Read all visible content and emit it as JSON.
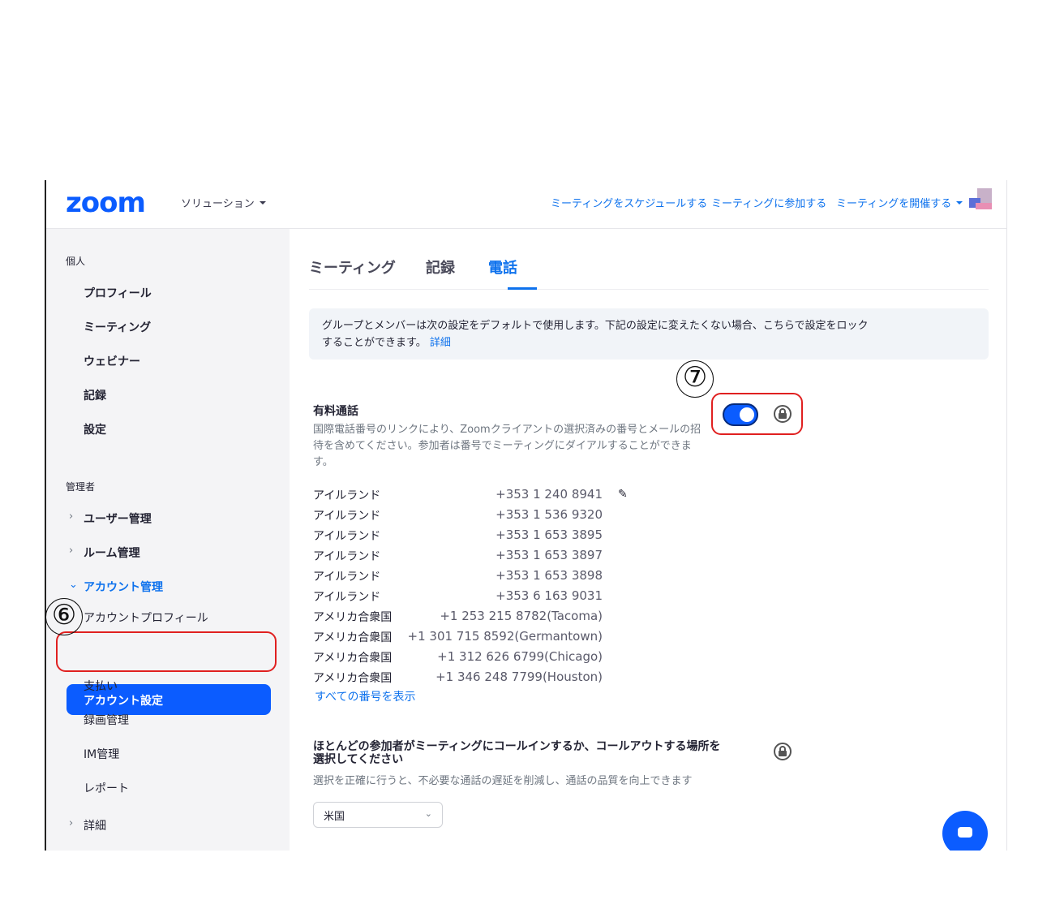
{
  "header": {
    "logo": "zoom",
    "solutions": "ソリューション",
    "nav": [
      "ミーティングをスケジュールする",
      "ミーティングに参加する",
      "ミーティングを開催する"
    ]
  },
  "sidebar": {
    "personal_label": "個人",
    "personal_items": [
      "プロフィール",
      "ミーティング",
      "ウェビナー",
      "記録",
      "設定"
    ],
    "admin_label": "管理者",
    "admin_items": {
      "user_mgmt": "ユーザー管理",
      "room_mgmt": "ルーム管理",
      "account_mgmt": "アカウント管理",
      "account_profile": "アカウントプロフィール",
      "account_settings": "アカウント設定",
      "billing": "支払い",
      "recording_mgmt": "録画管理",
      "im_mgmt": "IM管理",
      "reports": "レポート",
      "details": "詳細"
    }
  },
  "tabs": [
    "ミーティング",
    "記録",
    "電話"
  ],
  "notice": {
    "line1": "グループとメンバーは次の設定をデフォルトで使用します。下記の設定に変えたくない場合、こちらで設定をロック",
    "line2": "することができます。",
    "link": "詳細"
  },
  "toll_call": {
    "title": "有料通話",
    "description": "国際電話番号のリンクにより、Zoomクライアントの選択済みの番号とメールの招待を含めてください。参加者は番号でミーティングにダイアルすることができます。",
    "enabled": true,
    "numbers": [
      {
        "country": "アイルランド",
        "number": "+353 1 240 8941"
      },
      {
        "country": "アイルランド",
        "number": "+353 1 536 9320"
      },
      {
        "country": "アイルランド",
        "number": "+353 1 653 3895"
      },
      {
        "country": "アイルランド",
        "number": "+353 1 653 3897"
      },
      {
        "country": "アイルランド",
        "number": "+353 1 653 3898"
      },
      {
        "country": "アイルランド",
        "number": "+353 6 163 9031"
      },
      {
        "country": "アメリカ合衆国",
        "number": "+1 253 215 8782(Tacoma)"
      },
      {
        "country": "アメリカ合衆国",
        "number": "+1 301 715 8592(Germantown)"
      },
      {
        "country": "アメリカ合衆国",
        "number": "+1 312 626 6799(Chicago)"
      },
      {
        "country": "アメリカ合衆国",
        "number": "+1 346 248 7799(Houston)"
      }
    ],
    "show_all": "すべての番号を表示"
  },
  "callin_location": {
    "title_line1": "ほとんどの参加者がミーティングにコールインするか、コールアウトする場所を",
    "title_line2": "選択してください",
    "description": "選択を正確に行うと、不必要な通話の遅延を削減し、通話の品質を向上できます",
    "selected": "米国"
  },
  "annotations": {
    "step6": "⑥",
    "step7": "⑦",
    "highlight_color": "#e02020"
  },
  "colors": {
    "accent": "#0b5cff",
    "link": "#0e72ed"
  }
}
